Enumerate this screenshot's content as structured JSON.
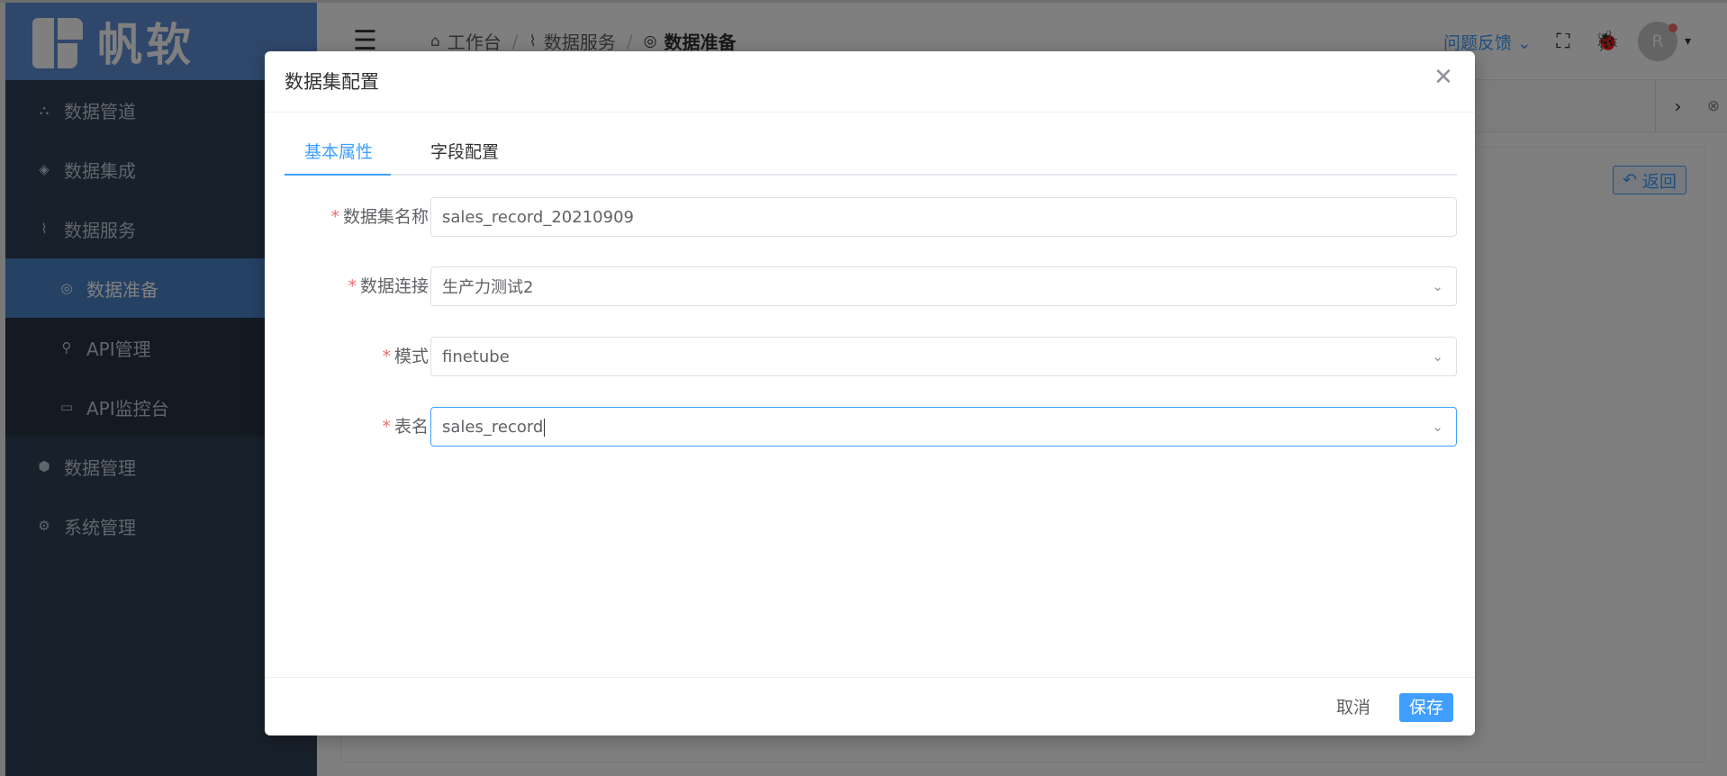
{
  "brand": {
    "logo_text": "帆软"
  },
  "sidebar": {
    "items": [
      {
        "label": "数据管道",
        "icon": "pipeline-icon"
      },
      {
        "label": "数据集成",
        "icon": "layers-icon"
      },
      {
        "label": "数据服务",
        "icon": "pulse-icon"
      },
      {
        "label": "数据准备",
        "icon": "gauge-icon",
        "active": true
      },
      {
        "label": "API管理",
        "icon": "api-icon"
      },
      {
        "label": "API监控台",
        "icon": "monitor-icon"
      },
      {
        "label": "数据管理",
        "icon": "cube-icon"
      },
      {
        "label": "系统管理",
        "icon": "gear-icon"
      }
    ]
  },
  "breadcrumb": {
    "home": "工作台",
    "service": "数据服务",
    "current": "数据准备"
  },
  "header": {
    "feedback_label": "问题反馈",
    "avatar_initial": "R"
  },
  "content": {
    "back_label": "返回"
  },
  "dialog": {
    "title": "数据集配置",
    "tabs": [
      {
        "label": "基本属性",
        "active": true
      },
      {
        "label": "字段配置"
      }
    ],
    "form": {
      "dataset_name": {
        "label": "数据集名称",
        "value": "sales_record_20210909"
      },
      "connection": {
        "label": "数据连接",
        "value": "生产力测试2"
      },
      "schema": {
        "label": "模式",
        "value": "finetube"
      },
      "table": {
        "label": "表名",
        "value": "sales_record"
      }
    },
    "cancel_label": "取消",
    "save_label": "保存"
  },
  "colors": {
    "primary": "#409eff",
    "sidebar_bg": "#304156",
    "sidebar_active": "#4a82c8",
    "logo_bg": "#5f8fd6",
    "required": "#f56c6c"
  }
}
